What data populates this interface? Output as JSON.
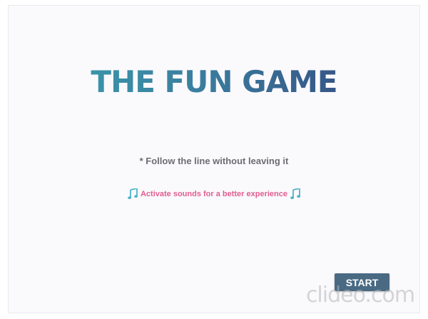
{
  "game": {
    "title": "THE FUN GAME",
    "instruction": "* Follow the line without leaving it",
    "sound_hint": "Activate sounds for a better experience",
    "start_label": "START"
  },
  "watermark": {
    "text": "clideo.com"
  },
  "icons": {
    "left": "music-note-icon",
    "right": "music-note-icon"
  },
  "colors": {
    "title_gradient_start": "#3aa3b0",
    "title_gradient_end": "#33407a",
    "instruction": "#6e6e72",
    "sound_hint": "#e05e8e",
    "note_icon": "#4fb3c9",
    "start_button": "#4a6a84",
    "background": "#faf9fc"
  }
}
